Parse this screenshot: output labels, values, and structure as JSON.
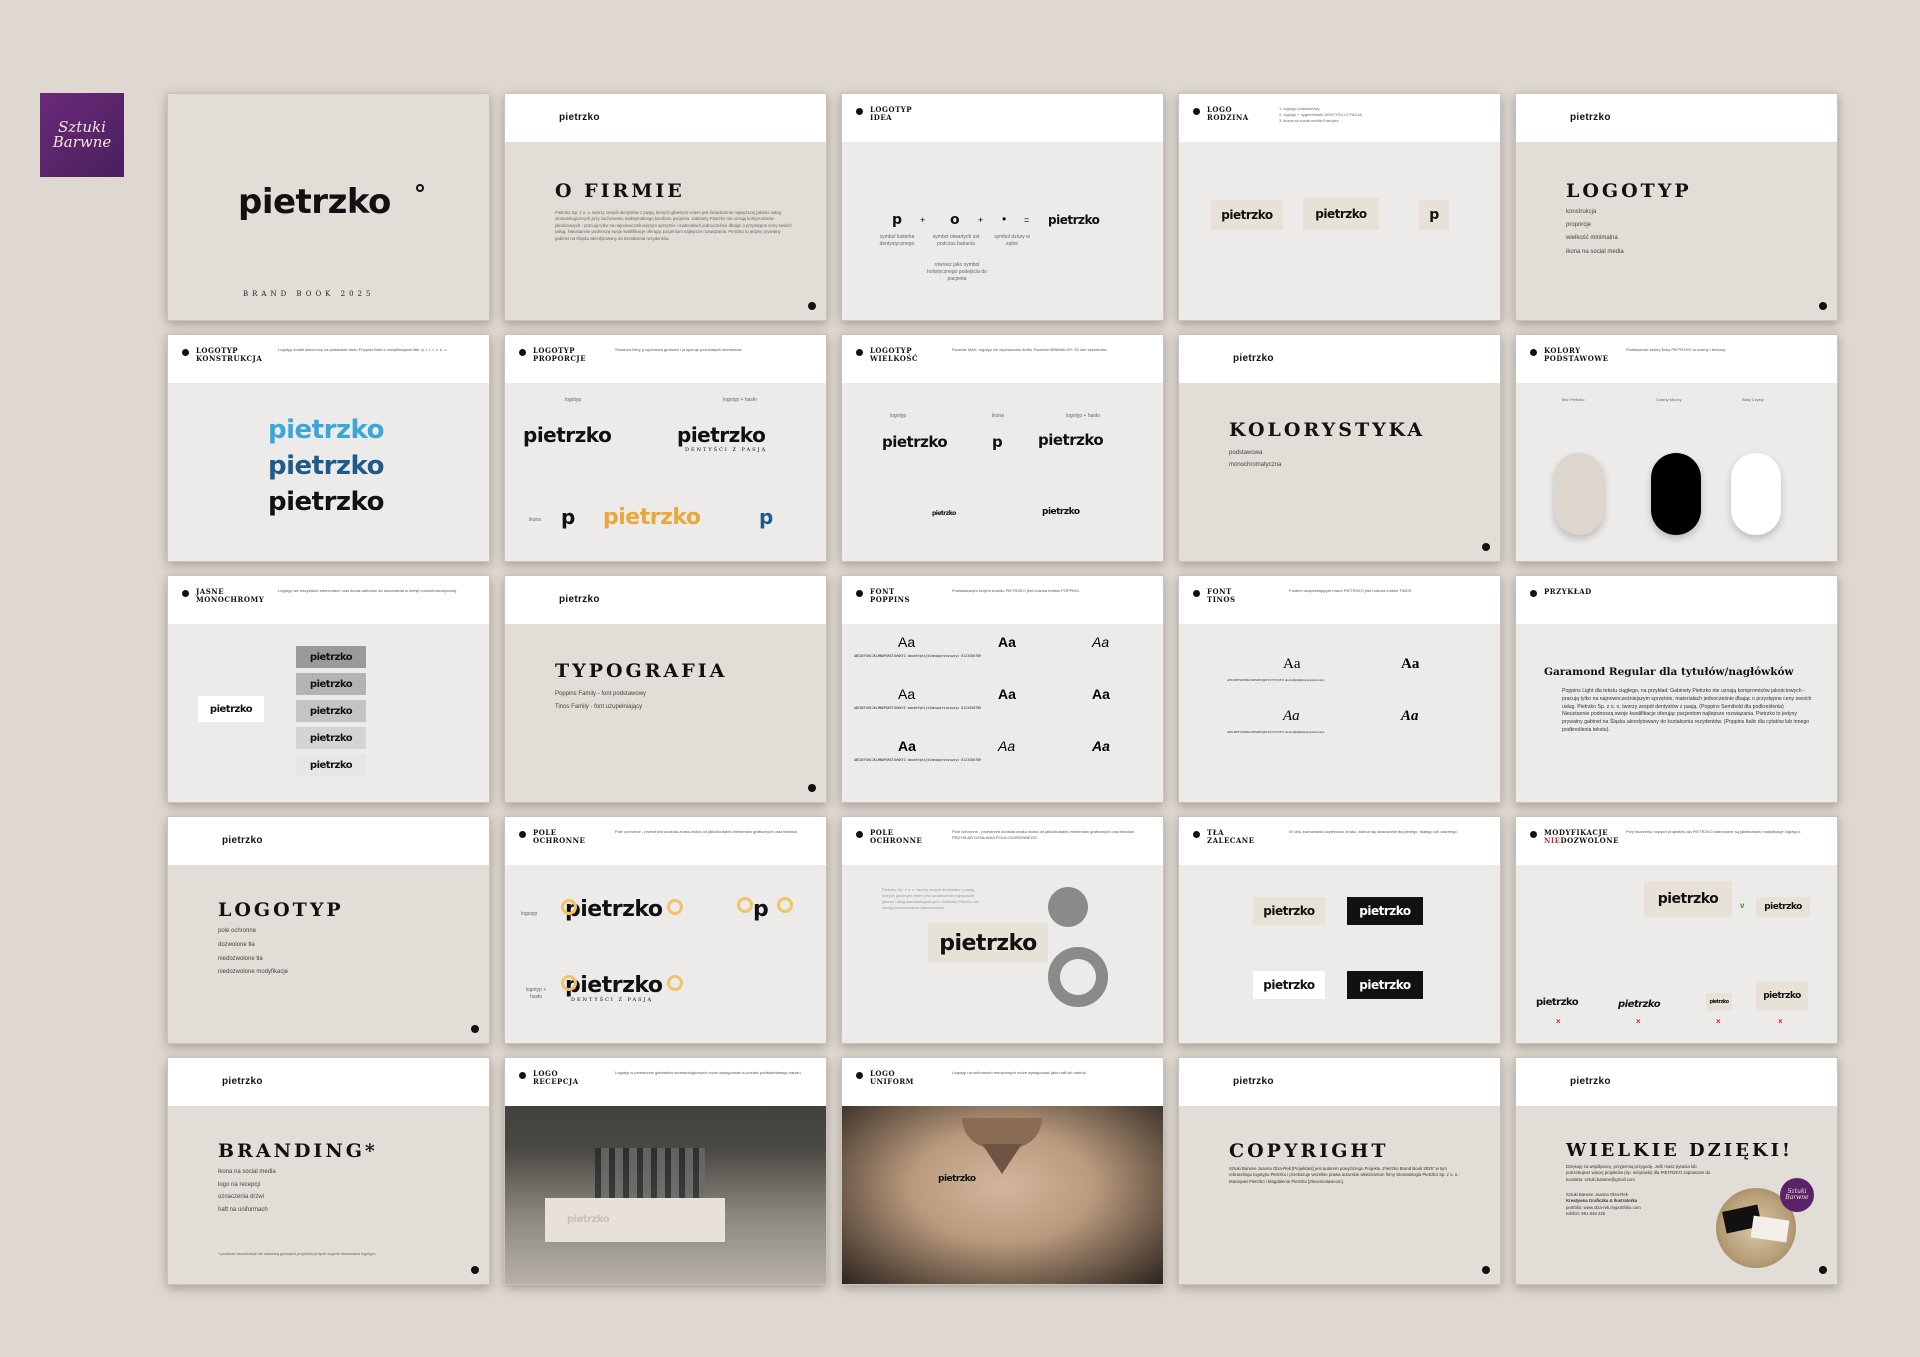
{
  "studio_logo": {
    "line1": "Sztuki",
    "line2": "Barwne"
  },
  "brand": "pietrzko",
  "brand_tagline": "DENTYŚCI Z PASJĄ",
  "slides": {
    "s1": {
      "logo": "pietrzko",
      "subtitle": "BRAND BOOK 2025"
    },
    "s2": {
      "logo": "pietrzko",
      "title": "O FIRMIE",
      "text": "Pietrzko Sp. z o. o. tworzy zespół dentystów z pasją, których głównym celem jest świadczenie najwyższej jakości usług stomatologicznych przy zachowaniu maksymalnego komfortu pacjenta. Gabinety Pietrzko nie uznają kompromisów jakościowych - pracują tylko na najnowocześniejszym sprzętnie i materiałach jednocześnie dbając o przystępne ceny swoich usług. Nieustannie podnoszą swoje kwalifikacje oferując pacjentom najlepsze rozwiązania. Pietrzko to jedyny prywatny gabinet na Śląsku akredytowany do kształcenia rezydentów."
    },
    "s3": {
      "h1": "LOGOTYP",
      "h2": "IDEA",
      "items": [
        "p",
        "+",
        "o",
        "+",
        "•",
        "=",
        "pietrzko"
      ],
      "cap1": "symbol lusterka dentystycznego",
      "cap2": "symbol otwartych ust podczas badania",
      "cap3": "symbol dziury w zębie",
      "cap4": "równiez jako symbol holistycznego podejścia do pacjenta"
    },
    "s4": {
      "h1": "LOGO",
      "h2": "RODZINA",
      "lines": [
        "1. logotyp podstawowy",
        "2. logotyp + sygnet/hasło DENTYŚCI Z PASJĄ",
        "3. ikona na social media Pracujes"
      ],
      "logo1": "pietrzko",
      "logo2": "pietrzko",
      "icon": "p"
    },
    "s5": {
      "logo": "pietrzko",
      "title": "LOGOTYP",
      "items": [
        "konstrukcja",
        "proporcje",
        "wielkość minimalna",
        "ikona na social media"
      ]
    },
    "s6": {
      "h1": "LOGOTYP",
      "h2": "KONSTRUKCJA",
      "text": "Logotyp został stworzony na podstawie fontu Poppins Bold z modyfikacjami liter: p, i, t, r, z, k, o."
    },
    "s7": {
      "h1": "LOGOTYP",
      "h2": "PROPORCJE",
      "cap1": "logotyp",
      "cap2": "logotyp + hasło",
      "cap3": "ikona",
      "text": "Struktura litery p wyznacza grubości i proporcje pozostałych elementów."
    },
    "s8": {
      "h1": "LOGOTYP",
      "h2": "WIELKOŚĆ",
      "text": "Rozmiar MAX: logotyp nie wyznaczono limitu. Rozmiar MINIMALNY: 20 mm szerokości.",
      "cap1": "logotyp",
      "cap2": "ikona",
      "cap3": "logotyp + hasło"
    },
    "s9": {
      "logo": "pietrzko",
      "title": "KOLORYSTYKA",
      "items": [
        "podstawowa",
        "monochromatyczna"
      ]
    },
    "s10": {
      "h1": "KOLORY",
      "h2": "PODSTAWOWE",
      "text": "Podstawowe kolory firmy PIETRZKO to czarny i beżowy.",
      "names": [
        "Beż Pietrzko",
        "Czarny Mocny",
        "Biały Czysty"
      ],
      "swatches": [
        "#dcd6cf",
        "#000000",
        "#ffffff"
      ]
    },
    "s11": {
      "h1": "JASNE",
      "h2": "MONOCHROMY",
      "text": "Logotyp we wszystkich elementach oraz ikona zalecane do stosowania w wersji monochromatycznej.",
      "logo": "pietrzko"
    },
    "s12": {
      "logo": "pietrzko",
      "title": "TYPOGRAFIA",
      "items": [
        "Poppins Family - font podstawowy",
        "Tinos Family - font uzupełniający"
      ]
    },
    "s13": {
      "h1": "FONT",
      "h2": "POPPINS",
      "text": "Podstawowym krojem brandu PIETRZKO jest rodzina fontów POPPINS.",
      "sample": "Aa"
    },
    "s14": {
      "h1": "FONT",
      "h2": "TINOS",
      "text": "Fontem uzupełniającym brand PIETRZKO jest rodzina fontów TINOS.",
      "sample": "Aa"
    },
    "s15": {
      "h1": "PRZYKŁAD",
      "heading": "Garamond Regular dla tytułów/nagłówków",
      "body": "Poppins Light dla tekstu ciągłego, na przykład: Gabinety Pietrzko nie uznają kompromisów jakościowych - pracują tylko na najnowocześniejszym sprzętnie, materiałach jednocześnie dbając o przystępne ceny swoich usług. Pietrzko Sp. z o. o. tworzy zespół dentystów z pasją. (Poppins Semibold dla podkreślenia) Nieustannie podnoszą swoje kwalifikacje oferując pacjentom najlepsze rozwiązania. Pietrzko to jedyny prywatny gabinet na Śląsku akredytowany do kształcenia rezydentów. (Poppins Italic dla cytatów lub innego podkreślenia tekstu)."
    },
    "s16": {
      "logo": "pietrzko",
      "title": "LOGOTYP",
      "items": [
        "pole ochronne",
        "dozwolone tła",
        "niedozwolone tła",
        "niedozwolone modyfikacje"
      ]
    },
    "s17": {
      "h1": "POLE",
      "h2": "OCHRONNE",
      "text": "Pole ochronne - przestrzeń dookoła znaku wolna od jakichkolwiek elementów graficznych oraz tekstów.",
      "cap1": "logotyp",
      "cap2": "logotyp + hasło"
    },
    "s18": {
      "h1": "POLE",
      "h2": "OCHRONNE",
      "text": "Pole ochronne - przestrzeń dookoła znaku wolna od jakichkolwiek elementów graficznych oraz tekstów. PRZYKŁAD DZIAŁANIA POLA OCHRONNEGO"
    },
    "s19": {
      "h1": "TŁA",
      "h2": "ZALECANE",
      "text": "W celu zachowania czytelności znaku, zaleca się stosowanie tła jasnego, białego lub czarnego."
    },
    "s20": {
      "h1": "MODYFIKACJE",
      "h2a": "NIE",
      "h2b": "DOZWOLONE",
      "text": "Przy tworzeniu nowych projektów dla PIETRZKO zabronione są jakiekolwiek modyfikacje logotypu."
    },
    "s21": {
      "logo": "pietrzko",
      "title": "BRANDING*",
      "items": [
        "ikona na social media",
        "logo na recepcji",
        "oznaczenia drzwi",
        "haft na uniformach"
      ],
      "note": "* poniższe wizualizacje nie stanowią gotowych projektów jedynie sugerie stosowania logotypu"
    },
    "s22": {
      "h1": "LOGO",
      "h2": "RECEPCJA",
      "text": "Logotyp w przestrzeni gabinetów stomatologicznych może występować w postaci podświetlanego napisu.",
      "logo": "pietrzko"
    },
    "s23": {
      "h1": "LOGO",
      "h2": "UNIFORM",
      "text": "Logotyp na uniformach medycznych może występować jako haft lub nadruk.",
      "logo": "pietrzko"
    },
    "s24": {
      "logo": "pietrzko",
      "title": "COPYRIGHT",
      "text": "Sztuki Barwne Joanna Olza-Rek [Projektant] jest autorem powyższego Projektu „Pietrzko Brand Book 2025” w tym rebrandingu logotypu Pietrzko i przekazuje wszelkie prawa autorskie właścicielom firmy Stomatologia Pietrzko Sp. z o. o.: Maciejowi Pietrzko i Magdalenie Pietrzko [Zleceniodawcom]."
    },
    "s25": {
      "logo": "pietrzko",
      "title": "WIELKIE DZIĘKI!",
      "text": "Dziękuję za współpracę, przyjemną przygodę. Jeśli masz pytania lub potrzebujesz więcej projektów (np. wizytówki) dla PIETRZKO zapraszam do kontaktu: sztuki.barwne@gmail.com",
      "sig1": "Sztuki Barwne Joanna Olza-Rek",
      "sig2": "Kreatywna Graficzka & Ilustratorka",
      "sig3": "portfolio: www.olza-rek.myportfolio.com",
      "sig4": "telefon: 591 848 225",
      "badge1": "Sztuki",
      "badge2": "Barwne"
    }
  },
  "colors": {
    "background": "#dfd8d0",
    "beige": "#e2ddd6",
    "black": "#111111",
    "accent_blue": "#3aa7d8",
    "accent_dark_blue": "#1e5b8a",
    "accent_orange": "#e8a93a",
    "purple": "#5a2368",
    "red": "#c9262c"
  }
}
